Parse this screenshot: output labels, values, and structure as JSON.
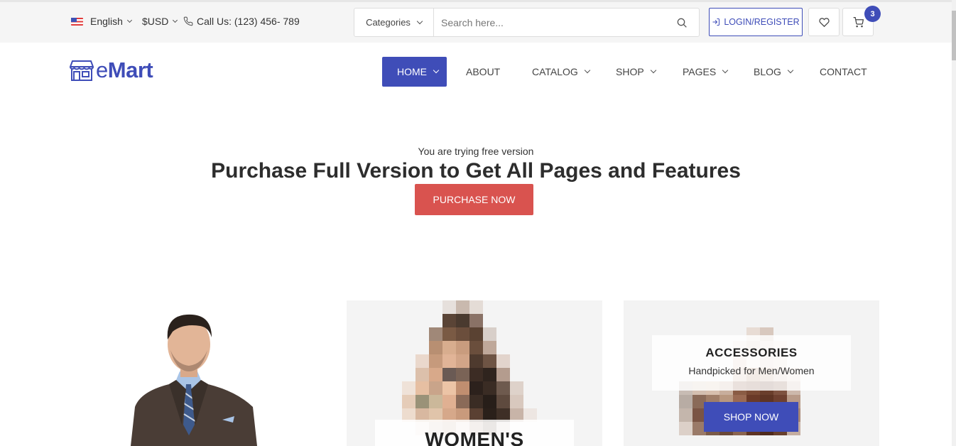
{
  "topbar": {
    "language": "English",
    "currency": "$USD",
    "phone": "Call Us: (123) 456- 789",
    "categories_label": "Categories",
    "search_placeholder": "Search here...",
    "login_label": "LOGIN/REGISTER",
    "cart_count": "3"
  },
  "logo": {
    "prefix": "e",
    "brand": "Mart"
  },
  "nav": {
    "home": "HOME",
    "about": "ABOUT",
    "catalog": "CATALOG",
    "shop": "SHOP",
    "pages": "PAGES",
    "blog": "BLOG",
    "contact": "CONTACT"
  },
  "promo": {
    "subtitle": "You are trying free version",
    "title": "Purchase Full Version to Get All Pages and Features",
    "button": "PURCHASE NOW"
  },
  "banners": {
    "women_label": "WOMEN'S",
    "accessories_title": "ACCESSORIES",
    "accessories_sub": "Handpicked for Men/Women",
    "shop_now": "SHOP NOW"
  },
  "colors": {
    "accent": "#3f4db8",
    "danger": "#d9534f",
    "topbar_bg": "#f5f5f5"
  },
  "icons": [
    "us-flag-icon",
    "phone-icon",
    "search-icon",
    "login-icon",
    "heart-icon",
    "cart-icon",
    "store-icon"
  ]
}
